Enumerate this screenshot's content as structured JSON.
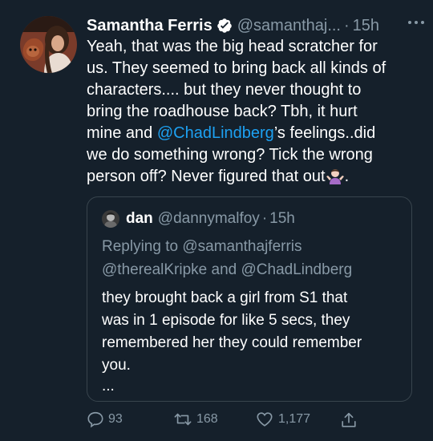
{
  "tweet": {
    "author_name": "Samantha Ferris",
    "handle": "@samanthaj...",
    "dot": "·",
    "time": "15h",
    "lines": [
      {
        "text": "Yeah, that was the big head scratcher for"
      },
      {
        "text": "us. They seemed to bring back all kinds of"
      },
      {
        "text": "characters.... but they never thought to"
      },
      {
        "text": "bring the roadhouse back? Tbh, it hurt"
      },
      {
        "pre": "mine and ",
        "mention": "@ChadLindberg",
        "post": "’s feelings..did"
      },
      {
        "text": "we do something wrong? Tick the wrong"
      },
      {
        "text": "person off? Never figured that out",
        "post": "."
      }
    ],
    "verified_icon": "verified-badge-icon",
    "more_icon": "more-options-icon",
    "emoji": "person-shrugging-emoji"
  },
  "quote": {
    "author_name": "dan",
    "handle": "@dannymalfoy",
    "dot": "·",
    "time": "15h",
    "reply_lines": [
      "Replying to @samanthajferris",
      "@therealKripke and @ChadLindberg"
    ],
    "text_lines": [
      "they brought back a girl from S1 that",
      "was in 1 episode for like 5 secs, they",
      "remembered her they could remember",
      "you."
    ],
    "more": "..."
  },
  "actions": {
    "reply_count": "93",
    "retweet_count": "168",
    "like_count": "1,177",
    "reply_icon": "reply-icon",
    "retweet_icon": "retweet-icon",
    "like_icon": "heart-icon",
    "share_icon": "share-icon"
  },
  "colors": {
    "background": "#15202b",
    "text": "#ffffff",
    "muted": "#8899a6",
    "link": "#1da1f2",
    "border": "#38444d"
  }
}
